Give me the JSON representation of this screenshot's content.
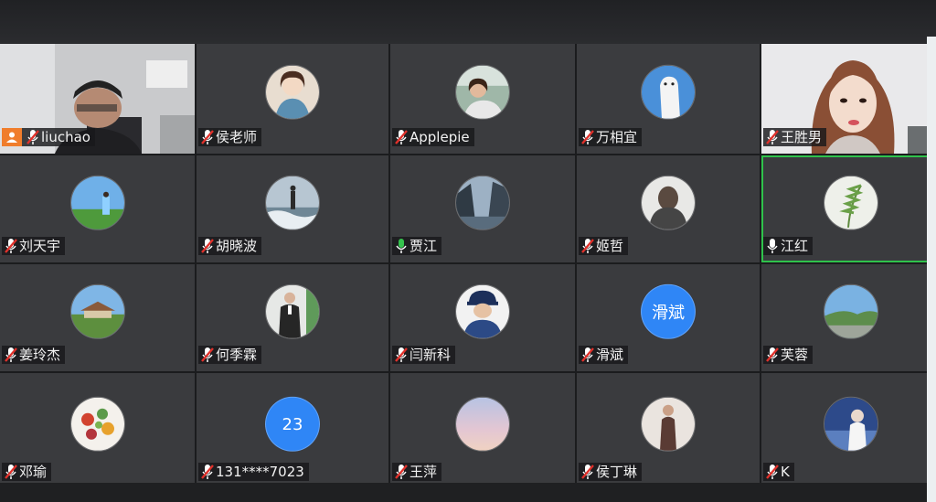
{
  "participants": [
    {
      "name": "liuchao",
      "mic": "muted",
      "video": true,
      "host": true
    },
    {
      "name": "侯老师",
      "mic": "muted"
    },
    {
      "name": "Applepie",
      "mic": "muted"
    },
    {
      "name": "万相宜",
      "mic": "muted"
    },
    {
      "name": "王胜男",
      "mic": "muted",
      "video": true
    },
    {
      "name": "刘天宇",
      "mic": "muted"
    },
    {
      "name": "胡晓波",
      "mic": "muted"
    },
    {
      "name": "贾江",
      "mic": "on"
    },
    {
      "name": "姬哲",
      "mic": "muted"
    },
    {
      "name": "江红",
      "mic": "on",
      "active": true
    },
    {
      "name": "姜玲杰",
      "mic": "muted"
    },
    {
      "name": "何季霖",
      "mic": "muted"
    },
    {
      "name": "闫新科",
      "mic": "muted"
    },
    {
      "name": "滑斌",
      "mic": "muted",
      "avatar_text": "滑斌"
    },
    {
      "name": "芙蓉",
      "mic": "muted"
    },
    {
      "name": "邓瑜",
      "mic": "muted"
    },
    {
      "name": "131****7023",
      "mic": "muted",
      "avatar_text": "23"
    },
    {
      "name": "王萍",
      "mic": "muted"
    },
    {
      "name": "侯丁琳",
      "mic": "muted"
    },
    {
      "name": "K",
      "mic": "muted"
    }
  ],
  "colors": {
    "muted": "#e0312b",
    "on": "#35c24e",
    "active_border": "#2fc24b",
    "avatar_text_bg": "#2f86f6"
  }
}
